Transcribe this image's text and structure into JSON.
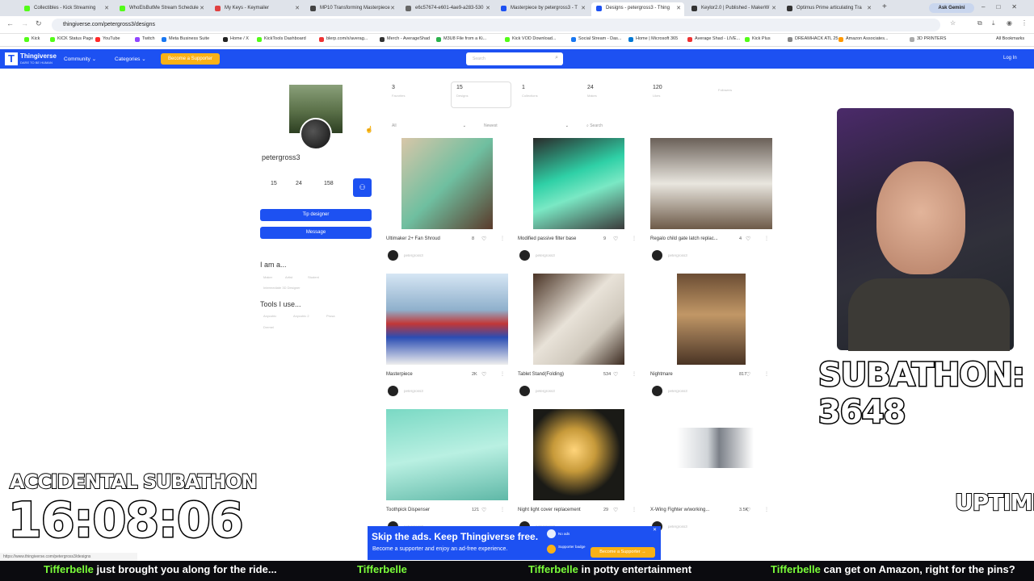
{
  "browser": {
    "tabs": [
      {
        "title": "Collectibles - Kick Streaming",
        "color": "#53fc18"
      },
      {
        "title": "WhoElsButMe Stream Schedule",
        "color": "#53fc18"
      },
      {
        "title": "My Keys - Keymailer",
        "color": "#e04040"
      },
      {
        "title": "MP10 Transforming Masterpiece",
        "color": "#444444"
      },
      {
        "title": "e6c57674-e601-4ae9-a283-530",
        "color": "#666666"
      },
      {
        "title": "Masterpiece by petergross3 - T",
        "color": "#1d51f2"
      },
      {
        "title": "Designs - petergross3 - Thing",
        "color": "#1d51f2"
      },
      {
        "title": "Keylor2.0 | Published - MakerW",
        "color": "#333333"
      },
      {
        "title": "Optimus Prime articulating Tra",
        "color": "#333333"
      }
    ],
    "ask_gemini": "Ask Gemini",
    "url": "thingiverse.com/petergross3/designs",
    "status_url": "https://www.thingiverse.com/petergross3/designs",
    "bookmarks": [
      "Kick",
      "KICK Status Page",
      "YouTube",
      "Twitch",
      "Meta Business Suite",
      "Home / X",
      "KickTools Dashboard",
      "blerp.com/x/averag...",
      "Merch - AverageShad",
      "M3U8 File from a Ki...",
      "Kick VOD Download...",
      "Social Stream - Das...",
      "Home | Microsoft 365",
      "Average Shad - LIVE...",
      "Kick Plus",
      "DREAMHACK ATL 25",
      "Amazon Associates...",
      "3D PRINTERS"
    ],
    "all_bookmarks": "All Bookmarks"
  },
  "site": {
    "logo_letter": "T",
    "brand": "Thingiverse",
    "tagline": "DARE TO BE HUMAN",
    "nav_community": "Community",
    "nav_categories": "Categories",
    "support_btn": "Become a Supporter",
    "search_placeholder": "Search",
    "login": "Log In"
  },
  "profile": {
    "username": "petergross3",
    "stats": [
      "15",
      "24",
      "158"
    ],
    "tip_btn": "Tip designer",
    "message_btn": "Message",
    "i_am": "I am a...",
    "i_am_tags": [
      "Maker",
      "Artist",
      "Student",
      "Intermediate 3D Designer"
    ],
    "tools": "Tools I use...",
    "tools_tags": [
      "Anycubic",
      "Anycubic 2",
      "Prusa",
      "Dremel"
    ]
  },
  "stat_tabs": [
    {
      "value": "3",
      "label": "Favorites"
    },
    {
      "value": "15",
      "label": "Designs"
    },
    {
      "value": "1",
      "label": "Collections"
    },
    {
      "value": "24",
      "label": "Makes"
    },
    {
      "value": "120",
      "label": "Likes"
    },
    {
      "value": "",
      "label": "Followers"
    }
  ],
  "filters": {
    "all": "All",
    "sort": "Newest",
    "search": "Search"
  },
  "designs": [
    {
      "title": "Ultimaker 2+ Fan Shroud",
      "likes": "8",
      "by": "petergross3"
    },
    {
      "title": "Modified passive filter base",
      "likes": "9",
      "by": "petergross3"
    },
    {
      "title": "Regalo child gate latch replac...",
      "likes": "4",
      "by": "petergross3"
    },
    {
      "title": "Masterpiece",
      "likes": "2K",
      "by": "petergross3"
    },
    {
      "title": "Tablet Stand(Folding)",
      "likes": "534",
      "by": "petergross3"
    },
    {
      "title": "Nightmare",
      "likes": "817",
      "by": "petergross3"
    },
    {
      "title": "Toothpick Dispenser",
      "likes": "121",
      "by": "petergross3"
    },
    {
      "title": "Night light cover replacement",
      "likes": "29",
      "by": "petergross3"
    },
    {
      "title": "X-Wing Fighter w/working...",
      "likes": "3.5K",
      "by": "petergross3"
    }
  ],
  "ad": {
    "title": "Skip the ads. Keep Thingiverse free.",
    "subtitle": "Become a supporter and enjoy an ad-free experience.",
    "no_ads": "No ads",
    "badge": "Supporter badge",
    "button": "Become a Supporter →"
  },
  "overlay": {
    "subathon": "SUBATHON: 3648",
    "accidental": "ACCIDENTAL SUBATHON",
    "timer": "16:08:06",
    "uptime": "UPTIME"
  },
  "ticker": [
    {
      "name": "Tifferbelle",
      "msg": "just brought you along for the ride..."
    },
    {
      "name": "Tifferbelle",
      "msg": ""
    },
    {
      "name": "Tifferbelle",
      "msg": "in potty entertainment"
    },
    {
      "name": "Tifferbelle",
      "msg": "can get on Amazon, right for the pins?"
    }
  ]
}
